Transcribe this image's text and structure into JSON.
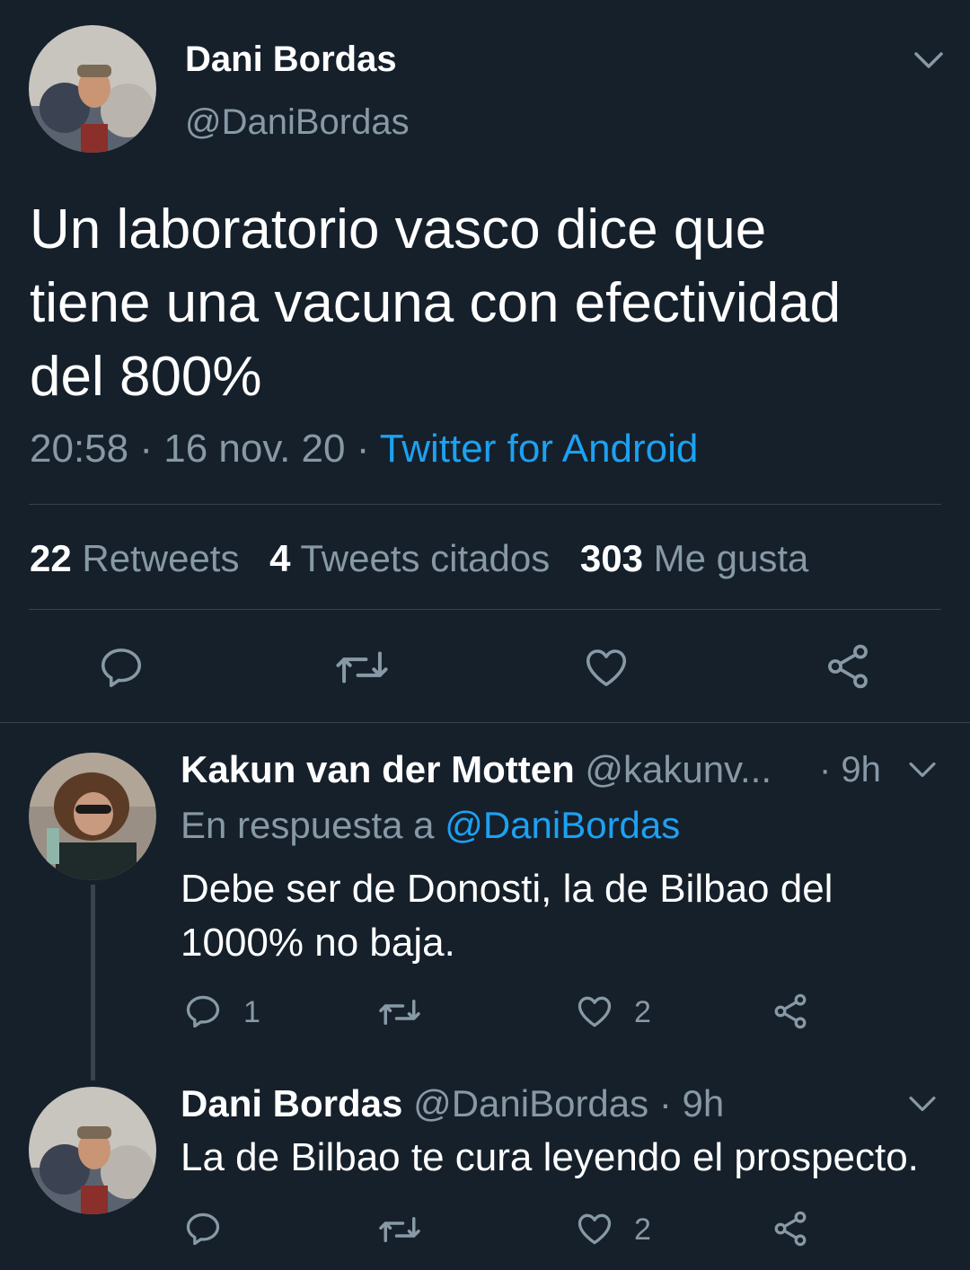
{
  "main_tweet": {
    "display_name": "Dani Bordas",
    "handle": "@DaniBordas",
    "text_lines": [
      "Un laboratorio vasco dice que",
      "tiene una vacuna con efectividad",
      "del 800%"
    ],
    "time": "20:58",
    "date": "16 nov. 20",
    "source": "Twitter for Android",
    "retweets_count": "22",
    "retweets_label": "Retweets",
    "quotes_count": "4",
    "quotes_label": "Tweets citados",
    "likes_count": "303",
    "likes_label": "Me gusta"
  },
  "reply1": {
    "display_name": "Kakun van der Motten",
    "handle": "@kakunv...",
    "time": "· 9h",
    "reply_prefix": "En respuesta a",
    "reply_to": "@DaniBordas",
    "text_lines": [
      "Debe ser de Donosti, la de Bilbao del",
      "1000% no baja."
    ],
    "reply_count": "1",
    "like_count": "2"
  },
  "reply2": {
    "display_name": "Dani Bordas",
    "handle": "@DaniBordas",
    "time": "· 9h",
    "text": "La de Bilbao te cura leyendo el prospecto.",
    "like_count": "2"
  },
  "colors": {
    "background": "#15202b",
    "text": "#ffffff",
    "muted": "#8899a6",
    "link": "#1da1f2",
    "divider": "#38444d"
  },
  "icons": [
    "reply-icon",
    "retweet-icon",
    "like-icon",
    "share-icon",
    "chevron-down-icon"
  ]
}
